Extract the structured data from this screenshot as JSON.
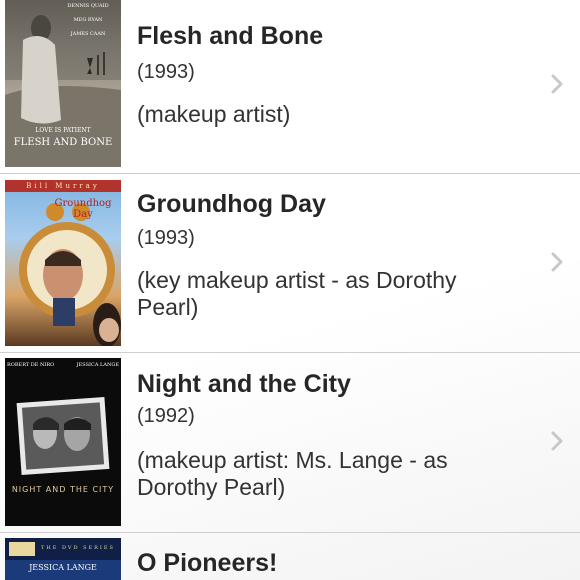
{
  "films": [
    {
      "title": "Flesh and Bone",
      "year": "(1993)",
      "role": "(makeup artist)",
      "poster": {
        "credits": [
          "DENNIS QUAID",
          "MEG RYAN",
          "JAMES CAAN"
        ],
        "tagline": "LOVE IS PATIENT",
        "title": "FLESH AND BONE"
      }
    },
    {
      "title": "Groundhog Day",
      "year": "(1993)",
      "role": "(key makeup artist - as Dorothy Pearl)",
      "poster": {
        "actor": "Bill Murray",
        "title_line1": "Groundhog",
        "title_line2": "Day"
      }
    },
    {
      "title": "Night and the City",
      "year": "(1992)",
      "role": "(makeup artist: Ms. Lange - as Dorothy Pearl)",
      "poster": {
        "actor_left": "ROBERT DE NIRO",
        "actor_right": "JESSICA LANGE",
        "title": "NIGHT AND THE CITY"
      }
    },
    {
      "title": "O Pioneers!",
      "year": "",
      "role": "",
      "poster": {
        "series": "THE DVD SERIES",
        "actor": "JESSICA LANGE"
      }
    }
  ],
  "colors": {
    "title_text": "#262626",
    "body_text": "#333333",
    "separator": "#cfcfcf",
    "chevron": "#c8c8c8"
  },
  "icons": {
    "disclosure": "chevron-right-icon"
  }
}
